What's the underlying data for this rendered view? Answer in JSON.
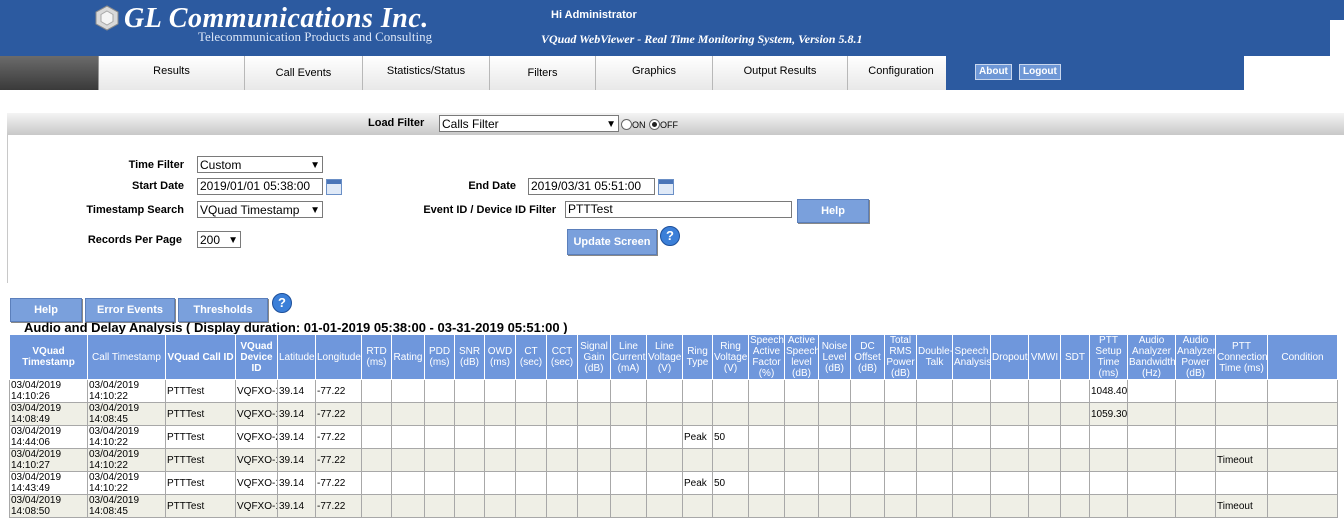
{
  "header": {
    "company": "GL Communications Inc.",
    "tagline": "Telecommunication Products and Consulting",
    "greeting": "Hi Administrator",
    "system": "VQuad WebViewer - Real Time Monitoring System, Version 5.8.1"
  },
  "menu": [
    "Results",
    "Call Events",
    "Statistics/Status",
    "Filters",
    "Graphics",
    "Output Results",
    "Configuration"
  ],
  "top_buttons": {
    "about": "About",
    "logout": "Logout"
  },
  "filter": {
    "load_filter_label": "Load Filter",
    "load_filter_value": "Calls Filter",
    "on_label": "ON",
    "off_label": "OFF",
    "selected": "OFF",
    "time_filter_label": "Time Filter",
    "time_filter_value": "Custom",
    "start_date_label": "Start Date",
    "start_date_value": "2019/01/01 05:38:00",
    "end_date_label": "End Date",
    "end_date_value": "2019/03/31 05:51:00",
    "timestamp_search_label": "Timestamp Search",
    "timestamp_search_value": "VQuad Timestamp",
    "event_id_label": "Event ID / Device ID Filter",
    "event_id_value": "PTTTest",
    "help_label": "Help",
    "records_label": "Records Per Page",
    "records_value": "200",
    "update_label": "Update Screen"
  },
  "actions": {
    "help": "Help",
    "error_events": "Error Events",
    "thresholds": "Thresholds"
  },
  "section_title": "Audio and Delay Analysis ( Display duration: 01-01-2019 05:38:00 - 03-31-2019 05:51:00 )",
  "table": {
    "columns": [
      "VQuad Timestamp",
      "Call Timestamp",
      "VQuad Call ID",
      "VQuad Device ID",
      "Latitude",
      "Longitude",
      "RTD (ms)",
      "Rating",
      "PDD (ms)",
      "SNR (dB)",
      "OWD (ms)",
      "CT (sec)",
      "CCT (sec)",
      "Signal Gain (dB)",
      "Line Current (mA)",
      "Line Voltage (V)",
      "Ring Type",
      "Ring Voltage (V)",
      "Speech Active Factor (%)",
      "Active Speech level (dB)",
      "Noise Level (dB)",
      "DC Offset (dB)",
      "Total RMS Power (dB)",
      "Double-Talk",
      "Speech Analysis",
      "Dropout",
      "VMWI",
      "SDT",
      "PTT Setup Time (ms)",
      "Audio Analyzer Bandwidth (Hz)",
      "Audio Analyzer Power (dB)",
      "PTT Connection Time (ms)",
      "Condition"
    ],
    "rows": [
      [
        "03/04/2019 14:10:26",
        "03/04/2019 14:10:22",
        "PTTTest",
        "VQFXO-1",
        "39.14",
        "-77.22",
        "",
        "",
        "",
        "",
        "",
        "",
        "",
        "",
        "",
        "",
        "",
        "",
        "",
        "",
        "",
        "",
        "",
        "",
        "",
        "",
        "",
        "",
        "1048.40",
        "",
        "",
        "",
        ""
      ],
      [
        "03/04/2019 14:08:49",
        "03/04/2019 14:08:45",
        "PTTTest",
        "VQFXO-1",
        "39.14",
        "-77.22",
        "",
        "",
        "",
        "",
        "",
        "",
        "",
        "",
        "",
        "",
        "",
        "",
        "",
        "",
        "",
        "",
        "",
        "",
        "",
        "",
        "",
        "",
        "1059.30",
        "",
        "",
        "",
        ""
      ],
      [
        "03/04/2019 14:44:06",
        "03/04/2019 14:10:22",
        "PTTTest",
        "VQFXO-2",
        "39.14",
        "-77.22",
        "",
        "",
        "",
        "",
        "",
        "",
        "",
        "",
        "",
        "",
        "Peak",
        "50",
        "",
        "",
        "",
        "",
        "",
        "",
        "",
        "",
        "",
        "",
        "",
        "",
        "",
        "",
        ""
      ],
      [
        "03/04/2019 14:10:27",
        "03/04/2019 14:10:22",
        "PTTTest",
        "VQFXO-1",
        "39.14",
        "-77.22",
        "",
        "",
        "",
        "",
        "",
        "",
        "",
        "",
        "",
        "",
        "",
        "",
        "",
        "",
        "",
        "",
        "",
        "",
        "",
        "",
        "",
        "",
        "",
        "",
        "",
        "Timeout",
        ""
      ],
      [
        "03/04/2019 14:43:49",
        "03/04/2019 14:10:22",
        "PTTTest",
        "VQFXO-1",
        "39.14",
        "-77.22",
        "",
        "",
        "",
        "",
        "",
        "",
        "",
        "",
        "",
        "",
        "Peak",
        "50",
        "",
        "",
        "",
        "",
        "",
        "",
        "",
        "",
        "",
        "",
        "",
        "",
        "",
        "",
        ""
      ],
      [
        "03/04/2019 14:08:50",
        "03/04/2019 14:08:45",
        "PTTTest",
        "VQFXO-1",
        "39.14",
        "-77.22",
        "",
        "",
        "",
        "",
        "",
        "",
        "",
        "",
        "",
        "",
        "",
        "",
        "",
        "",
        "",
        "",
        "",
        "",
        "",
        "",
        "",
        "",
        "",
        "",
        "",
        "Timeout",
        ""
      ]
    ]
  }
}
